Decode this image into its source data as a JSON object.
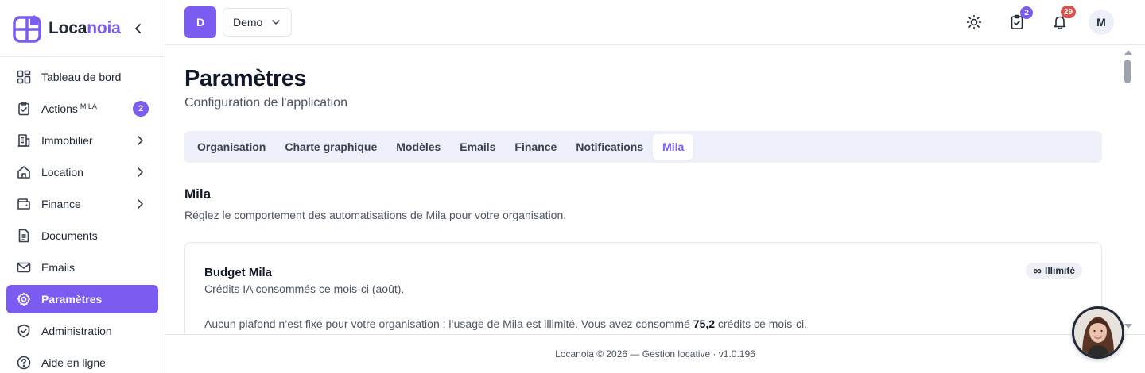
{
  "brand": {
    "name_part1": "Loca",
    "name_part2": "noia",
    "brand_color": "#7c5cf0"
  },
  "sidebar": {
    "items": [
      {
        "label": "Tableau de bord",
        "icon": "dashboard-icon"
      },
      {
        "label": "Actions",
        "sup": "MILA",
        "badge": "2",
        "icon": "clipboard-check-icon"
      },
      {
        "label": "Immobilier",
        "icon": "building-icon",
        "has_children": true
      },
      {
        "label": "Location",
        "icon": "home-icon",
        "has_children": true
      },
      {
        "label": "Finance",
        "icon": "wallet-icon",
        "has_children": true
      },
      {
        "label": "Documents",
        "icon": "document-icon"
      },
      {
        "label": "Emails",
        "icon": "mail-icon"
      },
      {
        "label": "Paramètres",
        "icon": "gear-icon",
        "active": true
      },
      {
        "label": "Administration",
        "icon": "shield-icon"
      },
      {
        "label": "Aide en ligne",
        "icon": "help-icon"
      }
    ]
  },
  "topbar": {
    "org_initial": "D",
    "org_name": "Demo",
    "tasks_badge": "2",
    "notifications_badge": "29",
    "user_initial": "M",
    "icons": [
      "sun-icon",
      "clipboard-check-icon",
      "bell-icon"
    ]
  },
  "main": {
    "title": "Paramètres",
    "subtitle": "Configuration de l'application",
    "tabs": [
      "Organisation",
      "Charte graphique",
      "Modèles",
      "Emails",
      "Finance",
      "Notifications",
      "Mila"
    ],
    "active_tab": "Mila",
    "section": {
      "title": "Mila",
      "description": "Réglez le comportement des automatisations de Mila pour votre organisation."
    },
    "card": {
      "title": "Budget Mila",
      "subtitle": "Crédits IA consommés ce mois-ci (août).",
      "badge_symbol": "∞",
      "badge": "Illimité",
      "text_before": "Aucun plafond n’est fixé pour votre organisation : l’usage de Mila est illimité. Vous avez consommé ",
      "consumed": "75,2",
      "text_after": " crédits ce mois-ci."
    }
  },
  "footer": {
    "text": "Locanoia © 2026 — Gestion locative · v1.0.196"
  }
}
